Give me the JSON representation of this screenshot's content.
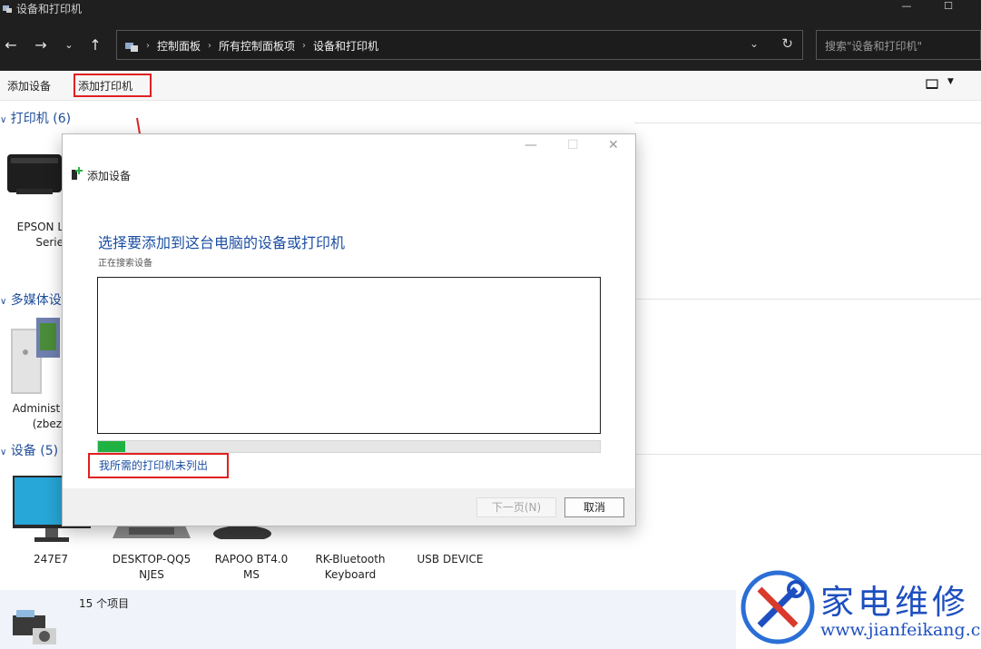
{
  "window": {
    "title": "设备和打印机"
  },
  "address_bar": {
    "crumbs": [
      "控制面板",
      "所有控制面板项",
      "设备和打印机"
    ],
    "search_placeholder": "搜索\"设备和打印机\""
  },
  "toolbar": {
    "add_device": "添加设备",
    "add_printer": "添加打印机"
  },
  "sections": {
    "printers": {
      "label": "打印机 (6)"
    },
    "multimedia": {
      "label": "多媒体设"
    },
    "devices": {
      "label": "设备 (5)"
    }
  },
  "printers": [
    {
      "line1": "EPSON L",
      "line2": "Serie"
    }
  ],
  "multimedia": [
    {
      "line1": "Administ",
      "line2": "(zbez"
    }
  ],
  "devices": [
    {
      "line1": "247E7",
      "line2": ""
    },
    {
      "line1": "DESKTOP-QQ5",
      "line2": "NJES"
    },
    {
      "line1": "RAPOO BT4.0",
      "line2": "MS"
    },
    {
      "line1": "RK-Bluetooth",
      "line2": "Keyboard"
    },
    {
      "line1": "USB DEVICE",
      "line2": ""
    }
  ],
  "status": {
    "count": "15 个项目"
  },
  "dialog": {
    "title": "添加设备",
    "heading": "选择要添加到这台电脑的设备或打印机",
    "subtitle": "正在搜索设备",
    "progress": 0.055,
    "link": "我所需的打印机未列出",
    "next_button": "下一页(N)",
    "cancel_button": "取消"
  },
  "watermark": {
    "title": "家电维修",
    "url": "www.jianfeikang.com"
  },
  "colors": {
    "accent": "#1d4fa3",
    "highlight_red": "#e02020",
    "progress_green": "#1fb141"
  }
}
